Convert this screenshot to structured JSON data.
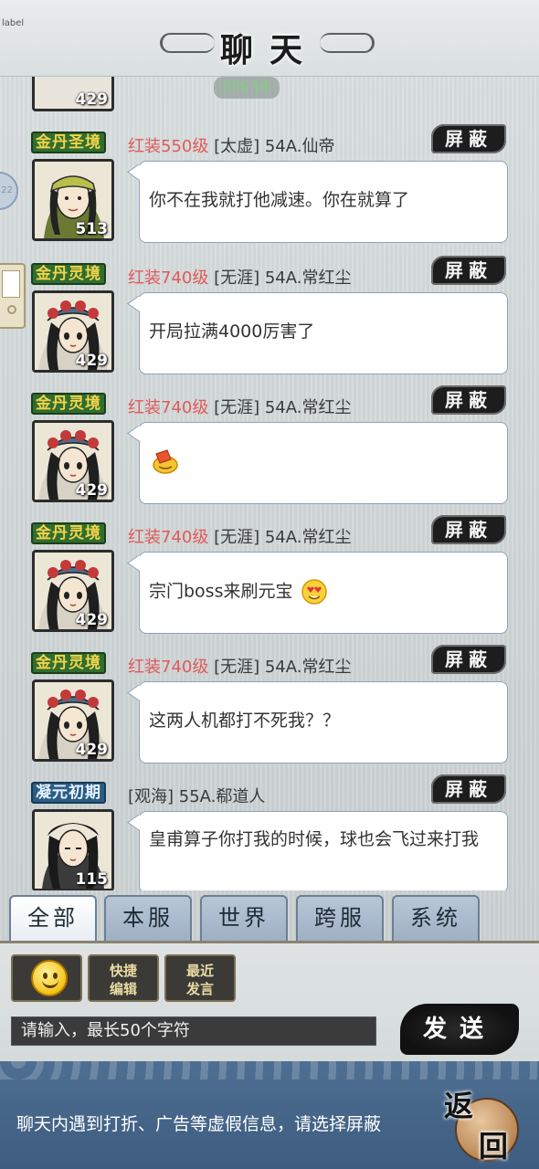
{
  "debug_label": "label",
  "header": {
    "title": "聊天",
    "fps": "FPS 58"
  },
  "top_partial_level": "429",
  "side_widget_text": "22",
  "block_label": "屏蔽",
  "messages": [
    {
      "rank": "金丹圣境",
      "rank_color": "green",
      "equip": "红装550级",
      "sender": "[太虚] 54A.仙帝",
      "level": "513",
      "text": "你不在我就打他减速。你在就算了",
      "avatar": "male-green-headband"
    },
    {
      "rank": "金丹灵境",
      "rank_color": "green",
      "equip": "红装740级",
      "sender": "[无涯] 54A.常红尘",
      "level": "429",
      "text": "开局拉满4000厉害了",
      "avatar": "female-blue-headdress"
    },
    {
      "rank": "金丹灵境",
      "rank_color": "green",
      "equip": "红装740级",
      "sender": "[无涯] 54A.常红尘",
      "level": "429",
      "text": "",
      "emoji": "wave-emoji",
      "avatar": "female-blue-headdress"
    },
    {
      "rank": "金丹灵境",
      "rank_color": "green",
      "equip": "红装740级",
      "sender": "[无涯] 54A.常红尘",
      "level": "429",
      "text": "宗门boss来刷元宝",
      "emoji": "heart-eyes-emoji",
      "avatar": "female-blue-headdress"
    },
    {
      "rank": "金丹灵境",
      "rank_color": "green",
      "equip": "红装740级",
      "sender": "[无涯] 54A.常红尘",
      "level": "429",
      "text": "这两人机都打不死我？？",
      "avatar": "female-blue-headdress"
    },
    {
      "rank": "凝元初期",
      "rank_color": "blue",
      "equip": "",
      "sender": "[观海] 55A.郗道人",
      "level": "115",
      "text": "皇甫算子你打我的时候，球也会飞过来打我",
      "avatar": "male-dark-hair"
    }
  ],
  "tabs": [
    "全部",
    "本服",
    "世界",
    "跨服",
    "系统"
  ],
  "active_tab": 0,
  "toolbar": {
    "emoji_icon": "smiley-icon",
    "quick_edit": "快捷编辑",
    "recent_say": "最近发言"
  },
  "input": {
    "placeholder": "请输入，最长50个字符"
  },
  "send_label": "发送",
  "footer_notice": "聊天内遇到打折、广告等虚假信息，请选择屏蔽",
  "back_label": {
    "a": "返",
    "b": "回"
  },
  "colors": {
    "equip_red": "#e05a5a",
    "rank_green": "#2f6e2e",
    "rank_blue": "#2a5d84",
    "bubble_border": "#8ea2b8",
    "footer_blue": "#4e6f92"
  }
}
